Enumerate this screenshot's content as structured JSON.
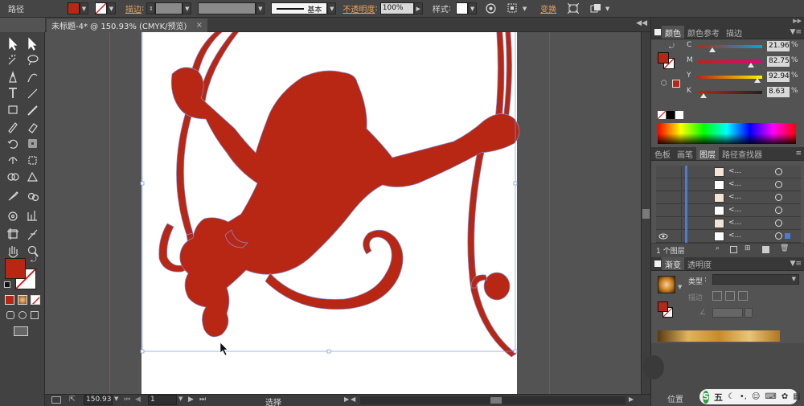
{
  "control_bar": {
    "label": "路径",
    "stroke_link": "描边",
    "stroke_weight": "",
    "profile_label": "基本",
    "opacity_link": "不透明度",
    "opacity_value": "100%",
    "style_label": "样式",
    "transform_link": "变换",
    "fill_color": "#b82714"
  },
  "document_tab": {
    "title": "未标题-4* @ 150.93% (CMYK/预览)",
    "close": "×"
  },
  "color_panel": {
    "tabs": [
      "颜色",
      "颜色参考",
      "描边"
    ],
    "channels": [
      {
        "letter": "C",
        "value": "21.96",
        "pct": "%",
        "level": 0.22,
        "color": "#00a2e8"
      },
      {
        "letter": "M",
        "value": "82.75",
        "pct": "%",
        "level": 0.83,
        "color": "#e4007f"
      },
      {
        "letter": "Y",
        "value": "92.94",
        "pct": "%",
        "level": 0.93,
        "color": "#fff100"
      },
      {
        "letter": "K",
        "value": "8.63",
        "pct": "%",
        "level": 0.09,
        "color": "#222222"
      }
    ],
    "fill_color": "#b82714"
  },
  "layers_panel": {
    "tabs": [
      "色板",
      "画笔",
      "图层",
      "路径查找器"
    ],
    "active_tab": 2,
    "layer_name": "<...",
    "count_label": "1 个图层",
    "layer_rows": 6
  },
  "gradient_panel": {
    "tabs": [
      "渐变",
      "透明度"
    ],
    "type_label": "类型",
    "stroke_label": "描边"
  },
  "status_bar": {
    "zoom": "150.93",
    "artboard_num": "1",
    "mode_label": "选择",
    "position_label": "位置"
  },
  "ime": {
    "logo": "S",
    "mode": "五"
  },
  "artwork": {
    "shape_color": "#b82714",
    "guide_color": "#c53a3a",
    "selection_color": "#7f93e0"
  }
}
